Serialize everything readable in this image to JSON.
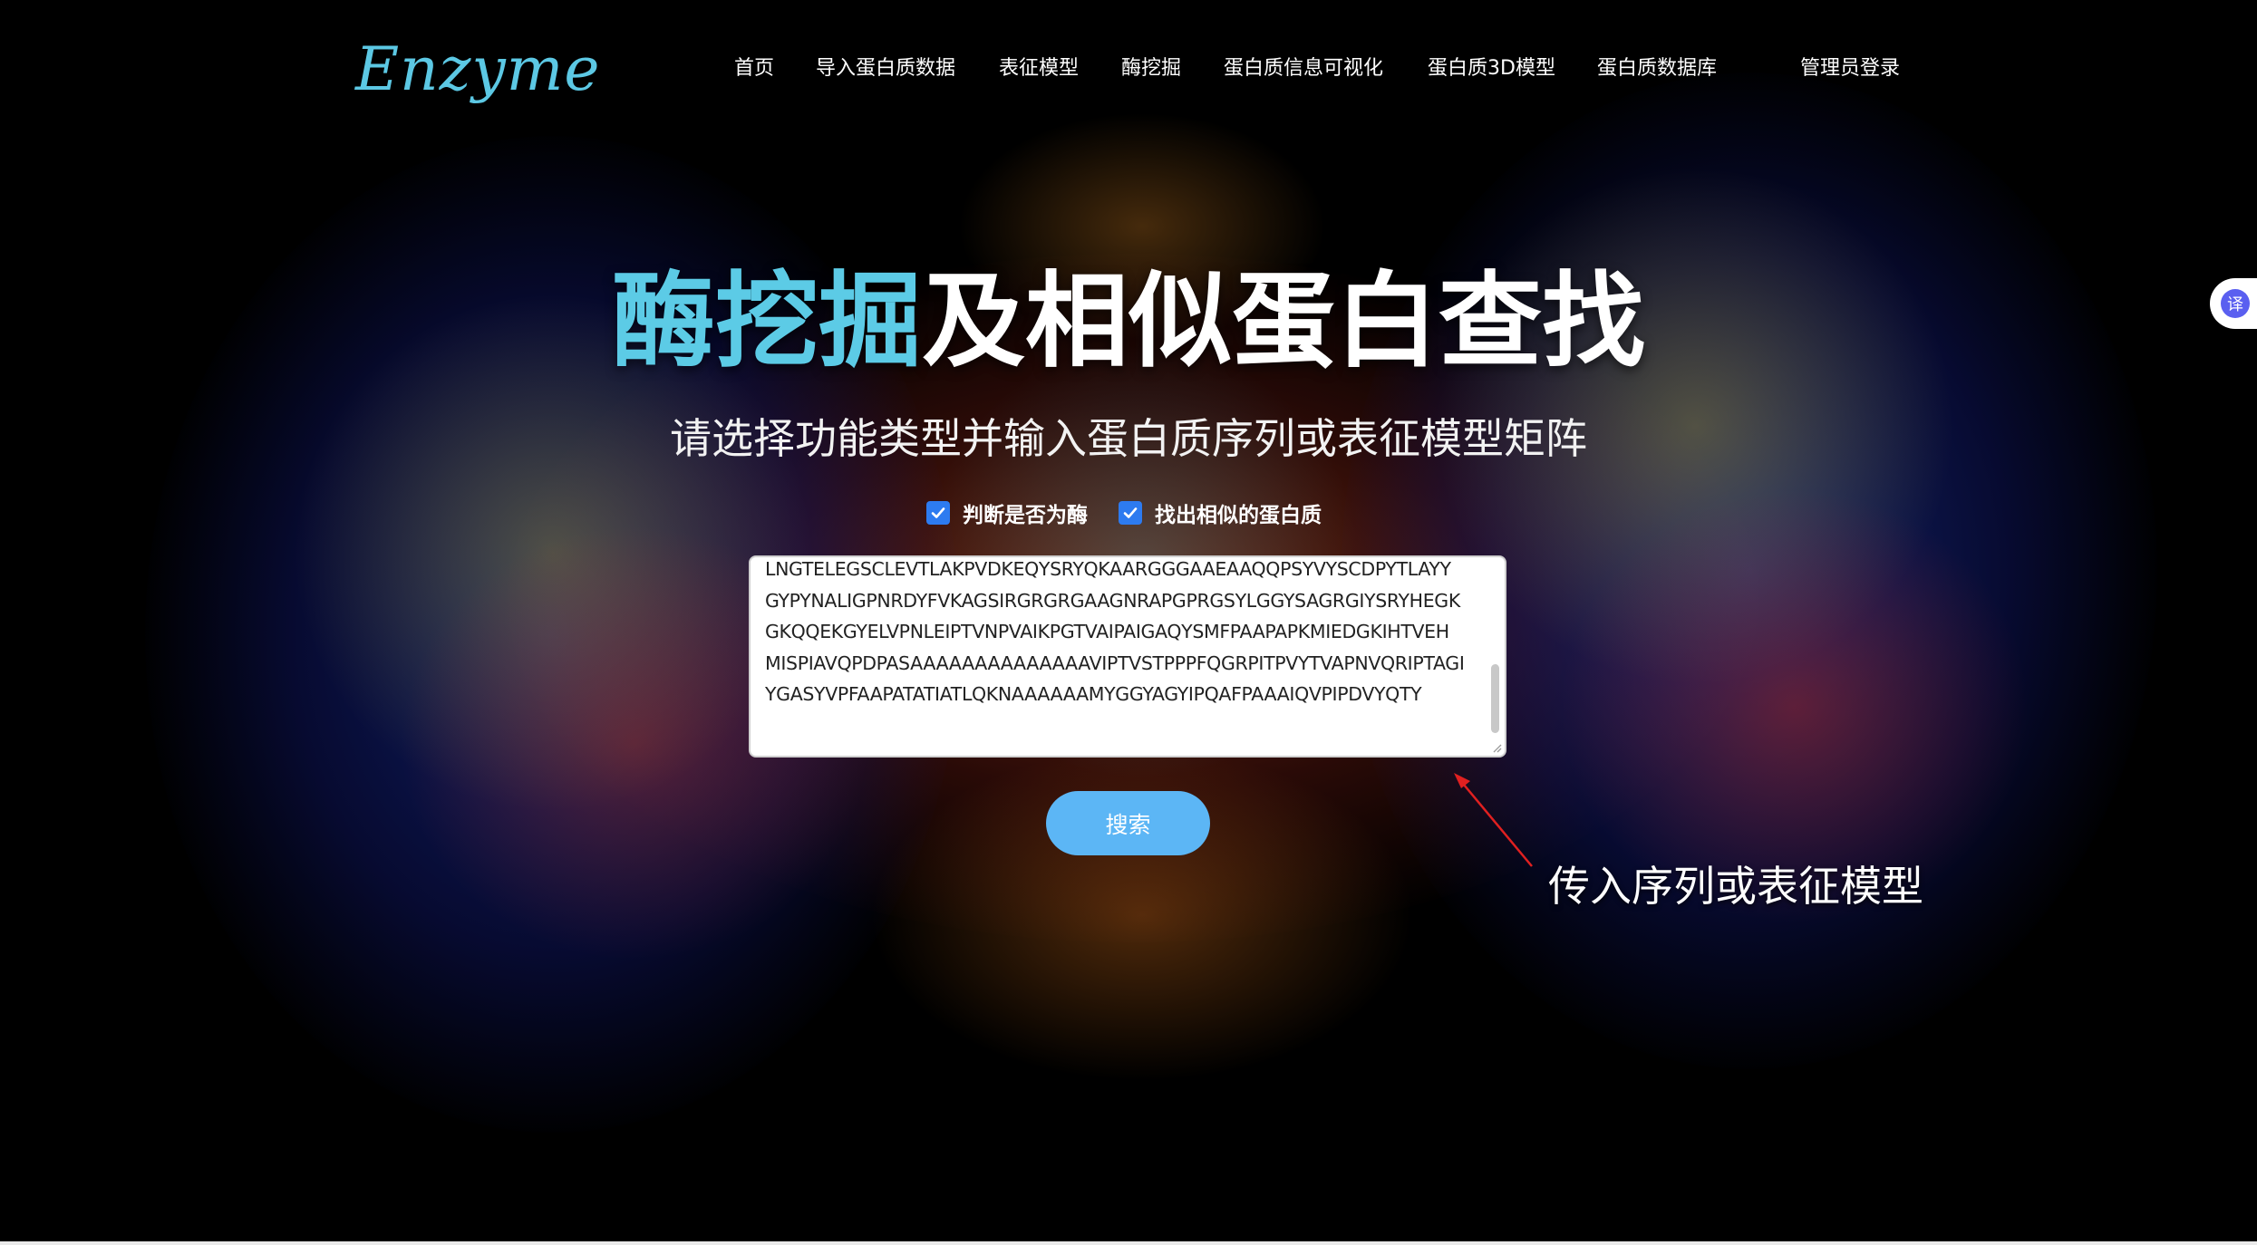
{
  "brand": {
    "logo": "Enzyme"
  },
  "nav": {
    "items": [
      "首页",
      "导入蛋白质数据",
      "表征模型",
      "酶挖掘",
      "蛋白质信息可视化",
      "蛋白质3D模型",
      "蛋白质数据库"
    ],
    "admin_login": "管理员登录"
  },
  "hero": {
    "title_accent": "酶挖掘",
    "title_rest": "及相似蛋白查找",
    "subtitle": "请选择功能类型并输入蛋白质序列或表征模型矩阵"
  },
  "options": {
    "is_enzyme": {
      "label": "判断是否为酶",
      "checked": true
    },
    "find_similar": {
      "label": "找出相似的蛋白质",
      "checked": true
    }
  },
  "sequence_input": {
    "value": "LNGTELEGSCLEVTLAKPVDKEQYSRYQKAARGGGAAEAAQQPSYVYSCDPYTLAYYGYPYNALIGPNRDYFVKAGSIRGRGRGAAGNRAPGPRGSYLGGYSAGRGIYSRYHEGKGKQQEKGYELVPNLEIPTVNPVAIKPGTVAIPAIGAQYSMFPAAPAPKMIEDGKIHTVEHMISPIAVQPDPASAAAAAAAAAAAAAAVIPTVSTPPPFQGRPITPVYTVAPNVQRIPTAGIYGASYVPFAAPATATIATLQKNAAAAAAMYGGYAGYIPQAFPAAAIQVPIPDVYQTY"
  },
  "search_button": {
    "label": "搜索"
  },
  "annotation": {
    "text": "传入序列或表征模型"
  },
  "translate": {
    "label": "译"
  },
  "colors": {
    "accent": "#5ccbe6",
    "button": "#5cb6f5",
    "checkbox": "#2d7bf0"
  }
}
